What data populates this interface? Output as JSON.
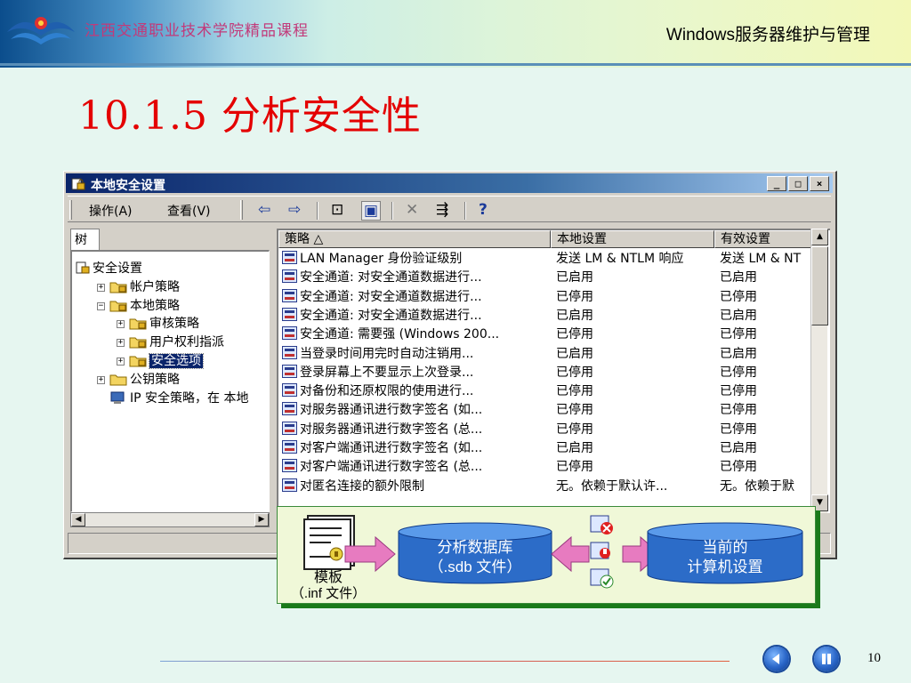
{
  "slide": {
    "school": "江西交通职业技术学院精品课程",
    "course": "Windows服务器维护与管理",
    "title": "10.1.5  分析安全性",
    "page": "10"
  },
  "window": {
    "title": "本地安全设置",
    "controls": {
      "minimize": "_",
      "maximize": "□",
      "close": "×"
    },
    "menu": {
      "action": "操作(A)",
      "view": "查看(V)"
    },
    "toolbar": {
      "back": "⇦",
      "forward": "⇨",
      "up": "⊡",
      "show_tree": "▣",
      "delete": "✕",
      "export": "⇶",
      "help": "?"
    }
  },
  "tree": {
    "tab": "树",
    "nodes": [
      {
        "label": "安全设置",
        "icon": "security-settings-icon",
        "level": 0,
        "toggle": ""
      },
      {
        "label": "帐户策略",
        "icon": "folder-policy-icon",
        "level": 1,
        "toggle": "+"
      },
      {
        "label": "本地策略",
        "icon": "folder-policy-icon",
        "level": 1,
        "toggle": "−"
      },
      {
        "label": "审核策略",
        "icon": "folder-policy-icon",
        "level": 2,
        "toggle": "+"
      },
      {
        "label": "用户权利指派",
        "icon": "folder-policy-icon",
        "level": 2,
        "toggle": "+"
      },
      {
        "label": "安全选项",
        "icon": "folder-policy-icon",
        "level": 2,
        "toggle": "+",
        "selected": true
      },
      {
        "label": "公钥策略",
        "icon": "folder-icon",
        "level": 1,
        "toggle": "+"
      },
      {
        "label": "IP 安全策略，在 本地",
        "icon": "ip-security-icon",
        "level": 1,
        "toggle": ""
      }
    ]
  },
  "list": {
    "columns": [
      "策略  △",
      "本地设置",
      "有效设置"
    ],
    "rows": [
      [
        "LAN Manager 身份验证级别",
        "发送 LM & NTLM 响应",
        "发送 LM & NT"
      ],
      [
        "安全通道: 对安全通道数据进行...",
        "已启用",
        "已启用"
      ],
      [
        "安全通道: 对安全通道数据进行...",
        "已停用",
        "已停用"
      ],
      [
        "安全通道: 对安全通道数据进行...",
        "已启用",
        "已启用"
      ],
      [
        "安全通道: 需要强 (Windows 200...",
        "已停用",
        "已停用"
      ],
      [
        "当登录时间用完时自动注销用...",
        "已启用",
        "已启用"
      ],
      [
        "登录屏幕上不要显示上次登录...",
        "已停用",
        "已停用"
      ],
      [
        "对备份和还原权限的使用进行...",
        "已停用",
        "已停用"
      ],
      [
        "对服务器通讯进行数字签名 (如...",
        "已停用",
        "已停用"
      ],
      [
        "对服务器通讯进行数字签名 (总...",
        "已停用",
        "已停用"
      ],
      [
        "对客户端通讯进行数字签名 (如...",
        "已启用",
        "已启用"
      ],
      [
        "对客户端通讯进行数字签名 (总...",
        "已停用",
        "已停用"
      ],
      [
        "对匿名连接的额外限制",
        "无。依赖于默认许...",
        "无。依赖于默"
      ]
    ]
  },
  "diagram": {
    "template_label": "模板",
    "template_sub": "（.inf 文件）",
    "db_line1": "分析数据库",
    "db_line2": "（.sdb 文件）",
    "computer_line1": "当前的",
    "computer_line2": "计算机设置"
  },
  "colors": {
    "title_red": "#e40000",
    "school_pink": "#c23a7a",
    "cylinder_blue": "#2c6cc8",
    "arrow_pink": "#e77bc0",
    "selection": "#0a246a"
  }
}
